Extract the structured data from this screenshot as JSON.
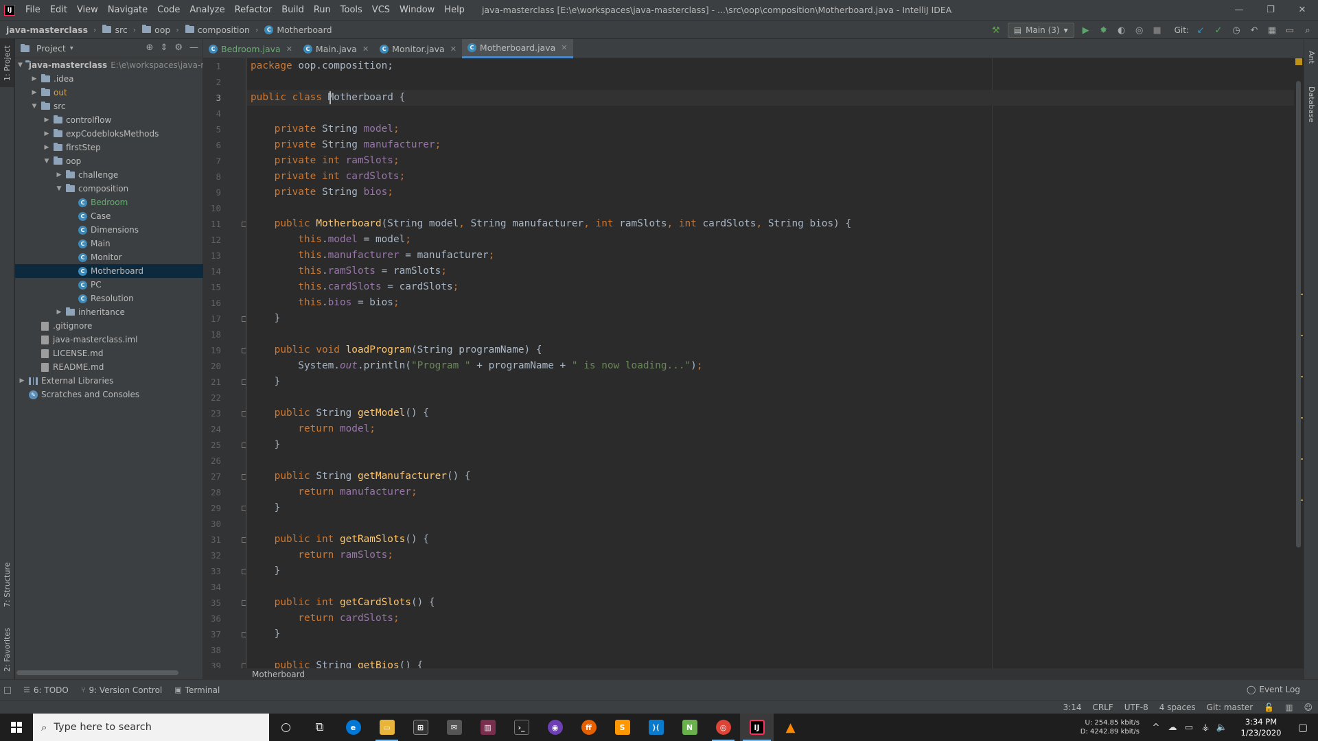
{
  "window": {
    "title": "java-masterclass [E:\\e\\workspaces\\java-masterclass] - ...\\src\\oop\\composition\\Motherboard.java - IntelliJ IDEA",
    "controls": [
      "—",
      "❐",
      "✕"
    ]
  },
  "menu": [
    "File",
    "Edit",
    "View",
    "Navigate",
    "Code",
    "Analyze",
    "Refactor",
    "Build",
    "Run",
    "Tools",
    "VCS",
    "Window",
    "Help"
  ],
  "nav_breadcrumb": [
    "java-masterclass",
    "src",
    "oop",
    "composition",
    "Motherboard"
  ],
  "run_config": {
    "label": "Main (3)"
  },
  "git_label": "Git:",
  "left_stripe": {
    "project": "1: Project",
    "structure": "7: Structure",
    "favorites": "2: Favorites"
  },
  "right_stripe": {
    "ant": "Ant",
    "database": "Database"
  },
  "project_panel": {
    "title": "Project",
    "tree": [
      {
        "label": "java-masterclass",
        "extra": "E:\\e\\workspaces\\java-mas",
        "level": 0,
        "arrow": "▼",
        "icon": "folder",
        "style": "bold"
      },
      {
        "label": ".idea",
        "level": 1,
        "arrow": "▶",
        "icon": "folder"
      },
      {
        "label": "out",
        "level": 1,
        "arrow": "▶",
        "icon": "folder",
        "style": "ex"
      },
      {
        "label": "src",
        "level": 1,
        "arrow": "▼",
        "icon": "folder"
      },
      {
        "label": "controlflow",
        "level": 2,
        "arrow": "▶",
        "icon": "folder"
      },
      {
        "label": "expCodebloksMethods",
        "level": 2,
        "arrow": "▶",
        "icon": "folder"
      },
      {
        "label": "firstStep",
        "level": 2,
        "arrow": "▶",
        "icon": "folder"
      },
      {
        "label": "oop",
        "level": 2,
        "arrow": "▼",
        "icon": "folder"
      },
      {
        "label": "challenge",
        "level": 3,
        "arrow": "▶",
        "icon": "folder"
      },
      {
        "label": "composition",
        "level": 3,
        "arrow": "▼",
        "icon": "folder"
      },
      {
        "label": "Bedroom",
        "level": 4,
        "arrow": "",
        "icon": "class",
        "style": "green"
      },
      {
        "label": "Case",
        "level": 4,
        "arrow": "",
        "icon": "class"
      },
      {
        "label": "Dimensions",
        "level": 4,
        "arrow": "",
        "icon": "class"
      },
      {
        "label": "Main",
        "level": 4,
        "arrow": "",
        "icon": "class"
      },
      {
        "label": "Monitor",
        "level": 4,
        "arrow": "",
        "icon": "class"
      },
      {
        "label": "Motherboard",
        "level": 4,
        "arrow": "",
        "icon": "class",
        "selected": true
      },
      {
        "label": "PC",
        "level": 4,
        "arrow": "",
        "icon": "class"
      },
      {
        "label": "Resolution",
        "level": 4,
        "arrow": "",
        "icon": "class"
      },
      {
        "label": "inheritance",
        "level": 3,
        "arrow": "▶",
        "icon": "folder"
      },
      {
        "label": ".gitignore",
        "level": 1,
        "arrow": "",
        "icon": "file"
      },
      {
        "label": "java-masterclass.iml",
        "level": 1,
        "arrow": "",
        "icon": "file"
      },
      {
        "label": "LICENSE.md",
        "level": 1,
        "arrow": "",
        "icon": "file"
      },
      {
        "label": "README.md",
        "level": 1,
        "arrow": "",
        "icon": "file"
      },
      {
        "label": "External Libraries",
        "level": 0,
        "arrow": "▶",
        "icon": "lib"
      },
      {
        "label": "Scratches and Consoles",
        "level": 0,
        "arrow": "",
        "icon": "scratch"
      }
    ]
  },
  "editor_tabs": [
    {
      "label": "Bedroom.java",
      "style": "green"
    },
    {
      "label": "Main.java"
    },
    {
      "label": "Monitor.java"
    },
    {
      "label": "Motherboard.java",
      "active": true
    }
  ],
  "code": {
    "caret_line": 3,
    "lines": [
      [
        [
          "kw",
          "package "
        ],
        [
          "",
          "oop.composition;"
        ]
      ],
      [],
      [
        [
          "kw",
          "public class "
        ],
        [
          "",
          "Motherboard {"
        ]
      ],
      [],
      [
        [
          "kw",
          "    private "
        ],
        [
          "",
          "String "
        ],
        [
          "fd",
          "model"
        ],
        [
          "kw",
          ";"
        ]
      ],
      [
        [
          "kw",
          "    private "
        ],
        [
          "",
          "String "
        ],
        [
          "fd",
          "manufacturer"
        ],
        [
          "kw",
          ";"
        ]
      ],
      [
        [
          "kw",
          "    private int "
        ],
        [
          "fd",
          "ramSlots"
        ],
        [
          "kw",
          ";"
        ]
      ],
      [
        [
          "kw",
          "    private int "
        ],
        [
          "fd",
          "cardSlots"
        ],
        [
          "kw",
          ";"
        ]
      ],
      [
        [
          "kw",
          "    private "
        ],
        [
          "",
          "String "
        ],
        [
          "fd",
          "bios"
        ],
        [
          "kw",
          ";"
        ]
      ],
      [],
      [
        [
          "kw",
          "    public "
        ],
        [
          "fn",
          "Motherboard"
        ],
        [
          "",
          "(String model"
        ],
        [
          "kw",
          ", "
        ],
        [
          "",
          "String manufacturer"
        ],
        [
          "kw",
          ", int "
        ],
        [
          "",
          "ramSlots"
        ],
        [
          "kw",
          ", int "
        ],
        [
          "",
          "cardSlots"
        ],
        [
          "kw",
          ", "
        ],
        [
          "",
          "String bios) {"
        ]
      ],
      [
        [
          "kw",
          "        this"
        ],
        [
          "",
          "."
        ],
        [
          "fd",
          "model "
        ],
        [
          "",
          "= model"
        ],
        [
          "kw",
          ";"
        ]
      ],
      [
        [
          "kw",
          "        this"
        ],
        [
          "",
          "."
        ],
        [
          "fd",
          "manufacturer "
        ],
        [
          "",
          "= manufacturer"
        ],
        [
          "kw",
          ";"
        ]
      ],
      [
        [
          "kw",
          "        this"
        ],
        [
          "",
          "."
        ],
        [
          "fd",
          "ramSlots "
        ],
        [
          "",
          "= ramSlots"
        ],
        [
          "kw",
          ";"
        ]
      ],
      [
        [
          "kw",
          "        this"
        ],
        [
          "",
          "."
        ],
        [
          "fd",
          "cardSlots "
        ],
        [
          "",
          "= cardSlots"
        ],
        [
          "kw",
          ";"
        ]
      ],
      [
        [
          "kw",
          "        this"
        ],
        [
          "",
          "."
        ],
        [
          "fd",
          "bios "
        ],
        [
          "",
          "= bios"
        ],
        [
          "kw",
          ";"
        ]
      ],
      [
        [
          "",
          "    }"
        ]
      ],
      [],
      [
        [
          "kw",
          "    public void "
        ],
        [
          "fn",
          "loadProgram"
        ],
        [
          "",
          "(String programName) {"
        ]
      ],
      [
        [
          "",
          "        System."
        ],
        [
          "it",
          "out"
        ],
        [
          "",
          ".println("
        ],
        [
          "st",
          "\"Program \" "
        ],
        [
          "",
          "+ programName + "
        ],
        [
          "st",
          "\" is now loading...\""
        ],
        [
          "",
          ")"
        ],
        [
          "kw",
          ";"
        ]
      ],
      [
        [
          "",
          "    }"
        ]
      ],
      [],
      [
        [
          "kw",
          "    public "
        ],
        [
          "",
          "String "
        ],
        [
          "fn",
          "getModel"
        ],
        [
          "",
          "() {"
        ]
      ],
      [
        [
          "kw",
          "        return "
        ],
        [
          "fd",
          "model"
        ],
        [
          "kw",
          ";"
        ]
      ],
      [
        [
          "",
          "    }"
        ]
      ],
      [],
      [
        [
          "kw",
          "    public "
        ],
        [
          "",
          "String "
        ],
        [
          "fn",
          "getManufacturer"
        ],
        [
          "",
          "() {"
        ]
      ],
      [
        [
          "kw",
          "        return "
        ],
        [
          "fd",
          "manufacturer"
        ],
        [
          "kw",
          ";"
        ]
      ],
      [
        [
          "",
          "    }"
        ]
      ],
      [],
      [
        [
          "kw",
          "    public int "
        ],
        [
          "fn",
          "getRamSlots"
        ],
        [
          "",
          "() {"
        ]
      ],
      [
        [
          "kw",
          "        return "
        ],
        [
          "fd",
          "ramSlots"
        ],
        [
          "kw",
          ";"
        ]
      ],
      [
        [
          "",
          "    }"
        ]
      ],
      [],
      [
        [
          "kw",
          "    public int "
        ],
        [
          "fn",
          "getCardSlots"
        ],
        [
          "",
          "() {"
        ]
      ],
      [
        [
          "kw",
          "        return "
        ],
        [
          "fd",
          "cardSlots"
        ],
        [
          "kw",
          ";"
        ]
      ],
      [
        [
          "",
          "    }"
        ]
      ],
      [],
      [
        [
          "kw",
          "    public "
        ],
        [
          "",
          "String "
        ],
        [
          "fn",
          "getBios"
        ],
        [
          "",
          "() {"
        ]
      ]
    ]
  },
  "editor_breadcrumb": "Motherboard",
  "bottom_tools": [
    {
      "icon": "☰",
      "label": "6: TODO"
    },
    {
      "icon": "⑂",
      "label": "9: Version Control"
    },
    {
      "icon": "▣",
      "label": "Terminal"
    }
  ],
  "event_log": "Event Log",
  "status": {
    "position": "3:14",
    "line_sep": "CRLF",
    "encoding": "UTF-8",
    "indent": "4 spaces",
    "git_branch": "Git: master"
  },
  "taskbar": {
    "search_placeholder": "Type here to search",
    "net_up": "U:     254.85 kbit/s",
    "net_down": "D:   4242.89 kbit/s",
    "time": "3:34 PM",
    "date": "1/23/2020"
  },
  "colors": {
    "accent": "#4a88c7",
    "keyword": "#cc7832",
    "field": "#9876aa",
    "method": "#ffc66d",
    "string": "#6a8759",
    "selection": "#0d293e"
  }
}
